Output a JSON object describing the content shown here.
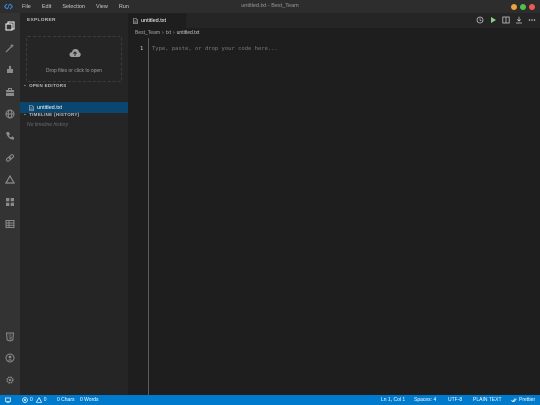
{
  "window": {
    "title": "untitled.txt - Best_Team",
    "menu": [
      "File",
      "Edit",
      "Selection",
      "View",
      "Run"
    ],
    "traffic_colors": [
      "#e9a33f",
      "#4ec24b",
      "#ef5a52"
    ]
  },
  "sidebar": {
    "title": "EXPLORER",
    "dropzone_text": "Drop files or click to open",
    "open_editors_label": "OPEN EDITORS",
    "open_editors": [
      {
        "name": "untitled.txt"
      }
    ],
    "timeline_label": "TIMELINE (HISTORY)",
    "timeline_empty": "No timeline history"
  },
  "editor": {
    "tab_label": "untitled.txt",
    "breadcrumb": [
      "Best_Team",
      "txt",
      "untitled.txt"
    ],
    "line_number": "1",
    "placeholder": "Type, paste, or drop your code here..."
  },
  "status": {
    "errors": "0",
    "warnings": "0",
    "chars": "0 Chars",
    "words": "0 Words",
    "position": "Ln 1, Col 1",
    "spaces": "Spaces: 4",
    "encoding": "UTF-8",
    "language": "PLAIN TEXT",
    "formatter": "Prettier"
  },
  "colors": {
    "accent": "#007acc",
    "selection": "#094771",
    "run_green": "#89d185"
  }
}
